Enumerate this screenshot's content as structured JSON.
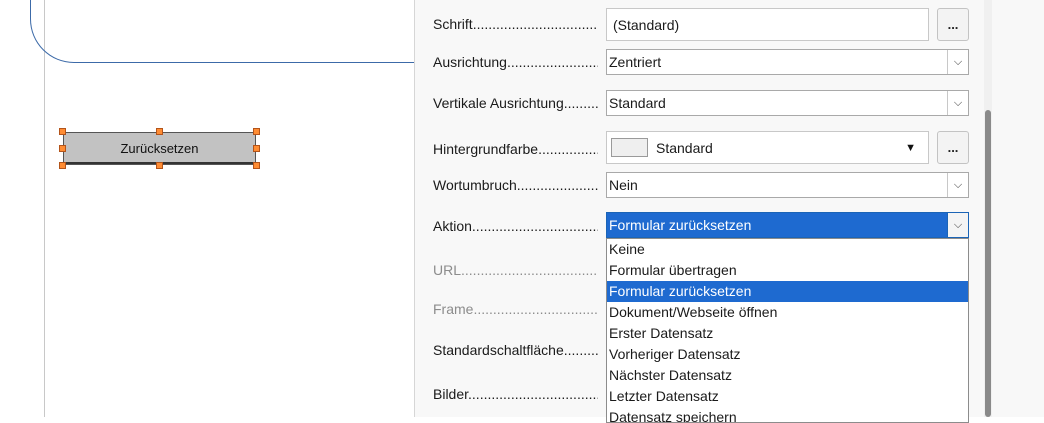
{
  "canvas": {
    "button_label": "Zurücksetzen"
  },
  "properties": {
    "font": {
      "label": "Schrift",
      "value": "(Standard)",
      "button": "..."
    },
    "alignment": {
      "label": "Ausrichtung",
      "value": "Zentriert"
    },
    "vertical_alignment": {
      "label": "Vertikale Ausrichtung",
      "value": "Standard"
    },
    "background_color": {
      "label": "Hintergrundfarbe",
      "value": "Standard",
      "swatch_color": "#efefef",
      "button": "..."
    },
    "word_wrap": {
      "label": "Wortumbruch",
      "value": "Nein"
    },
    "action": {
      "label": "Aktion",
      "value": "Formular zurücksetzen"
    },
    "url": {
      "label": "URL"
    },
    "frame": {
      "label": "Frame"
    },
    "default_button": {
      "label": "Standardschaltfläche"
    },
    "images": {
      "label": "Bilder"
    }
  },
  "dropdown": {
    "options": [
      "Keine",
      "Formular übertragen",
      "Formular zurücksetzen",
      "Dokument/Webseite öffnen",
      "Erster Datensatz",
      "Vorheriger Datensatz",
      "Nächster Datensatz",
      "Letzter Datensatz",
      "Datensatz speichern"
    ],
    "selected_index": 2
  },
  "colors": {
    "selection": "#1e6ad0",
    "handle": "#ff8c33",
    "frame_border": "#3c6aa8"
  }
}
